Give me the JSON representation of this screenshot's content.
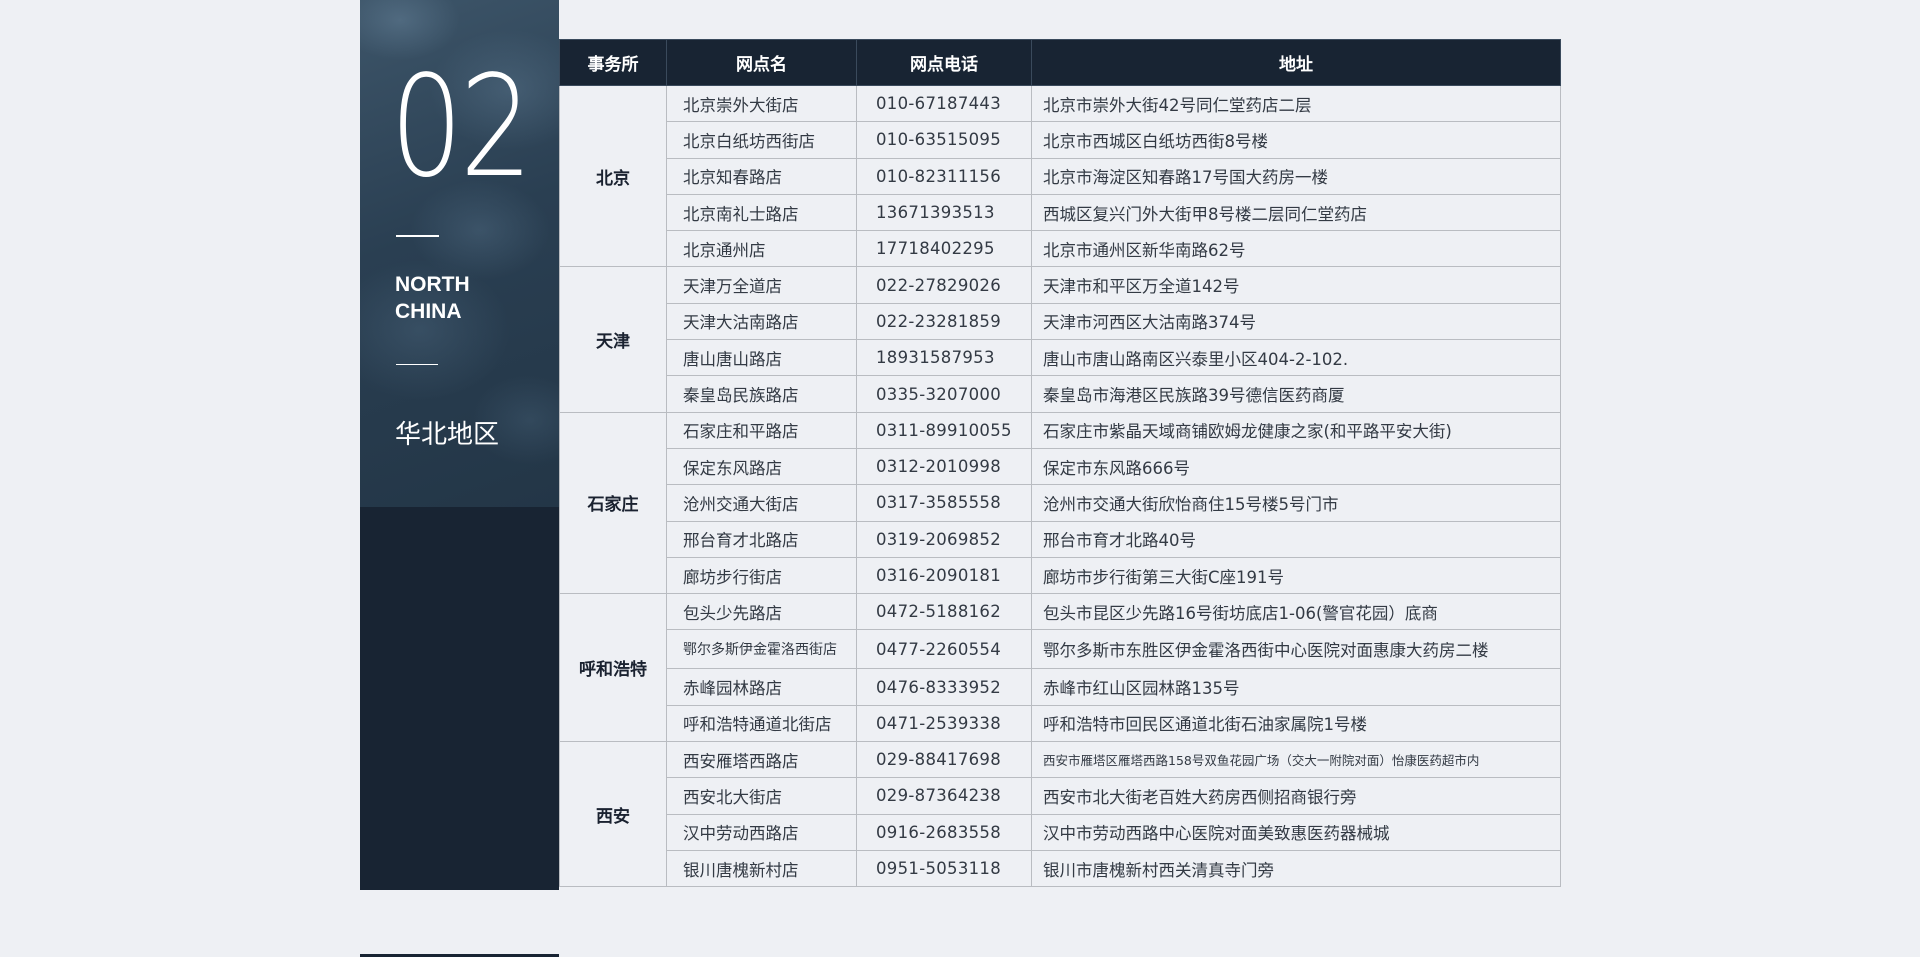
{
  "panel": {
    "number": "02",
    "region_en_line1": "NORTH",
    "region_en_line2": "CHINA",
    "region_zh": "华北地区"
  },
  "table": {
    "headers": [
      "事务所",
      "网点名",
      "网点电话",
      "地址"
    ],
    "groups": [
      {
        "office": "北京",
        "rows": [
          {
            "store": "北京崇外大街店",
            "phone": "010-67187443",
            "address": "北京市崇外大街42号同仁堂药店二层"
          },
          {
            "store": "北京白纸坊西街店",
            "phone": "010-63515095",
            "address": "北京市西城区白纸坊西街8号楼"
          },
          {
            "store": "北京知春路店",
            "phone": "010-82311156",
            "address": "北京市海淀区知春路17号国大药房一楼"
          },
          {
            "store": "北京南礼士路店",
            "phone": "13671393513",
            "address": "西城区复兴门外大街甲8号楼二层同仁堂药店"
          },
          {
            "store": "北京通州店",
            "phone": "17718402295",
            "address": "北京市通州区新华南路62号"
          }
        ]
      },
      {
        "office": "天津",
        "rows": [
          {
            "store": "天津万全道店",
            "phone": "022-27829026",
            "address": "天津市和平区万全道142号"
          },
          {
            "store": "天津大沽南路店",
            "phone": "022-23281859",
            "address": "天津市河西区大沽南路374号"
          },
          {
            "store": "唐山唐山路店",
            "phone": "18931587953",
            "address": "唐山市唐山路南区兴泰里小区404-2-102."
          },
          {
            "store": "秦皇岛民族路店",
            "phone": "0335-3207000",
            "address": "秦皇岛市海港区民族路39号德信医药商厦"
          }
        ]
      },
      {
        "office": "石家庄",
        "rows": [
          {
            "store": "石家庄和平路店",
            "phone": "0311-89910055",
            "address": "石家庄市紫晶天域商铺欧姆龙健康之家(和平路平安大街)"
          },
          {
            "store": "保定东风路店",
            "phone": "0312-2010998",
            "address": "保定市东风路666号"
          },
          {
            "store": "沧州交通大街店",
            "phone": "0317-3585558",
            "address": "沧州市交通大街欣怡商住15号楼5号门市"
          },
          {
            "store": "邢台育才北路店",
            "phone": "0319-2069852",
            "address": "邢台市育才北路40号"
          },
          {
            "store": "廊坊步行街店",
            "phone": "0316-2090181",
            "address": "廊坊市步行街第三大街C座191号"
          }
        ]
      },
      {
        "office": "呼和浩特",
        "rows": [
          {
            "store": "包头少先路店",
            "phone": "0472-5188162",
            "address": "包头市昆区少先路16号街坊底店1-06(警官花园）底商"
          },
          {
            "store": "鄂尔多斯伊金霍洛西街店",
            "phone": "0477-2260554",
            "address": "鄂尔多斯市东胜区伊金霍洛西街中心医院对面惠康大药房二楼"
          },
          {
            "store": "赤峰园林路店",
            "phone": "0476-8333952",
            "address": "赤峰市红山区园林路135号"
          },
          {
            "store": "呼和浩特通道北街店",
            "phone": "0471-2539338",
            "address": "呼和浩特市回民区通道北街石油家属院1号楼"
          }
        ]
      },
      {
        "office": "西安",
        "rows": [
          {
            "store": "西安雁塔西路店",
            "phone": "029-88417698",
            "address": "西安市雁塔区雁塔西路158号双鱼花园广场（交大一附院对面）怡康医药超市内"
          },
          {
            "store": "西安北大街店",
            "phone": "029-87364238",
            "address": "西安市北大街老百姓大药房西侧招商银行旁"
          },
          {
            "store": "汉中劳动西路店",
            "phone": "0916-2683558",
            "address": "汉中市劳动西路中心医院对面美致惠医药器械城"
          },
          {
            "store": "银川唐槐新村店",
            "phone": "0951-5053118",
            "address": "银川市唐槐新村西关清真寺门旁"
          }
        ]
      }
    ]
  }
}
